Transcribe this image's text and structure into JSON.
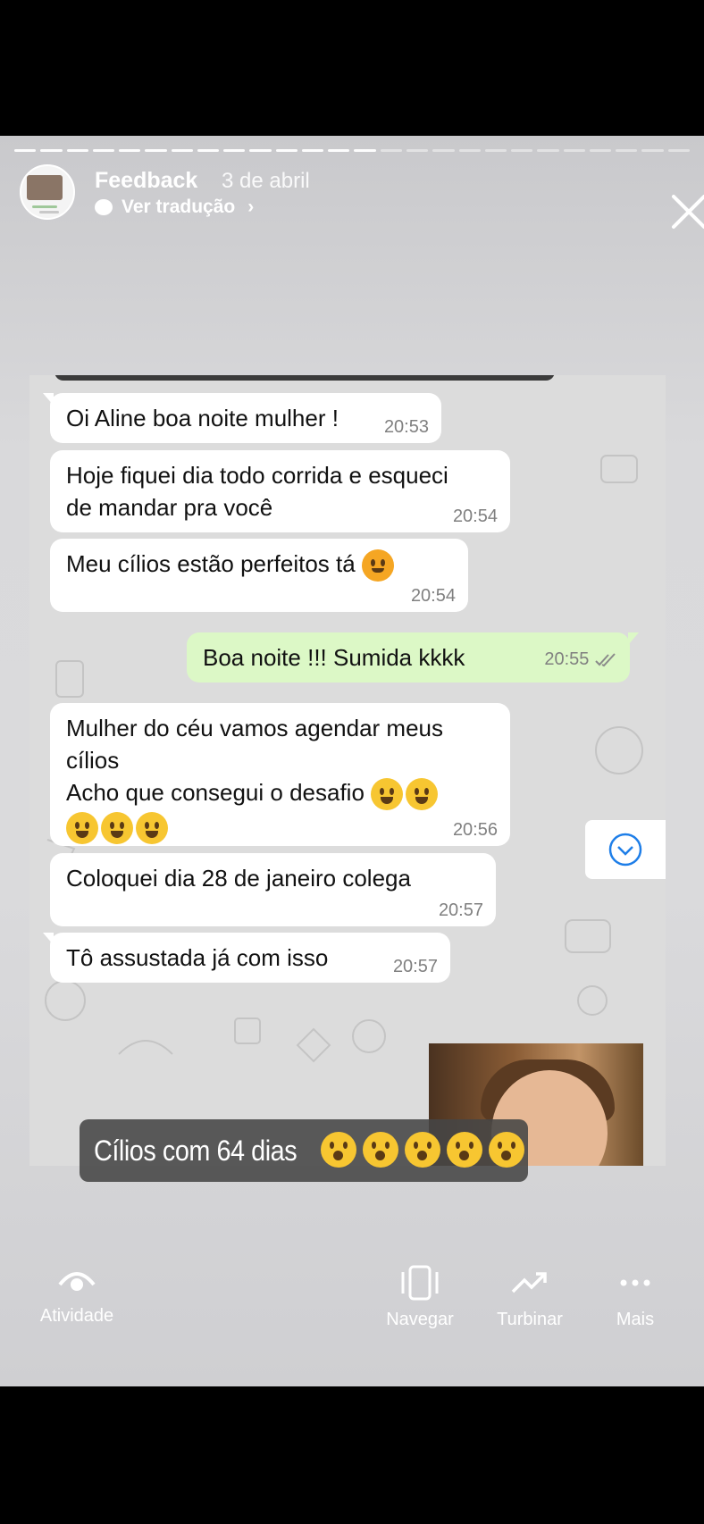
{
  "story": {
    "account": "Feedback",
    "date": "3 de abril",
    "translate_label": "Ver tradução",
    "progress_total": 26,
    "progress_done": 14
  },
  "chat": {
    "messages": [
      {
        "dir": "in",
        "text": "Oi Aline boa noite mulher !",
        "time": "20:53"
      },
      {
        "dir": "in",
        "text": "Hoje fiquei dia todo corrida e esqueci\nde mandar pra você",
        "time": "20:54"
      },
      {
        "dir": "in",
        "text": "Meu cílios estão perfeitos tá",
        "time": "20:54"
      },
      {
        "dir": "out",
        "text": "Boa noite !!! Sumida kkkk",
        "time": "20:55"
      },
      {
        "dir": "in",
        "text": "Mulher do céu vamos agendar meus\ncílios\nAcho que consegui o desafio",
        "time": "20:56"
      },
      {
        "dir": "in",
        "text": "Coloquei dia 28 de janeiro colega",
        "time": "20:57"
      },
      {
        "dir": "in",
        "text": "Tô assustada já com isso",
        "time": "20:57"
      }
    ]
  },
  "caption": {
    "text": "Cílios com 64 dias"
  },
  "bottom": {
    "activity": "Atividade",
    "navigate": "Navegar",
    "boost": "Turbinar",
    "more": "Mais"
  },
  "colors": {
    "incoming": "#ffffff",
    "outgoing": "#dcf8c6",
    "check": "#8a8a8a"
  }
}
